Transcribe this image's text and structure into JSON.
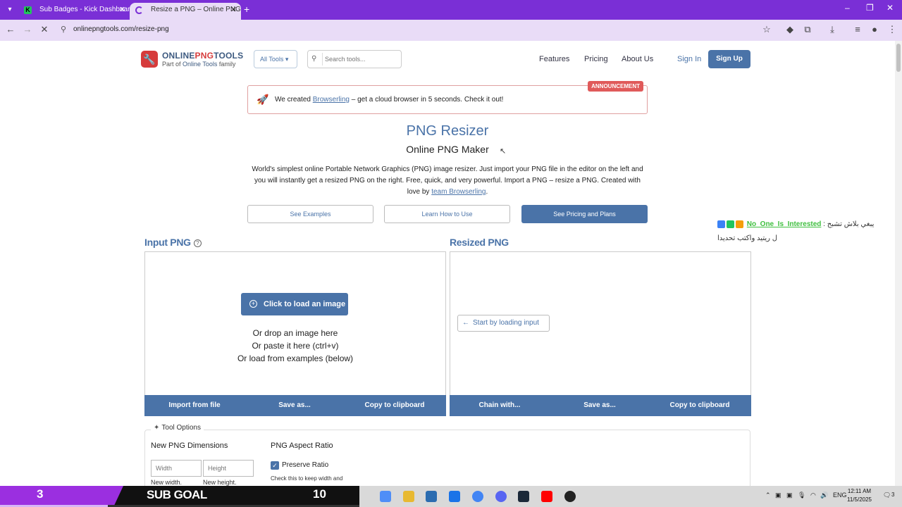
{
  "browser": {
    "tabs": [
      {
        "title": "Sub Badges - Kick Dashboard"
      },
      {
        "title": "Resize a PNG – Online PNG Ma"
      }
    ],
    "url": "onlinepngtools.com/resize-png"
  },
  "header": {
    "brand_online": "ONLINE",
    "brand_png": "PNG",
    "brand_tools": "TOOLS",
    "brand_sub_prefix": "Part of ",
    "brand_sub_link": "Online Tools",
    "brand_sub_suffix": " family",
    "all_tools": "All Tools",
    "search_placeholder": "Search tools...",
    "nav": [
      "Features",
      "Pricing",
      "About Us"
    ],
    "sign_in": "Sign In",
    "sign_up": "Sign Up"
  },
  "announcement": {
    "prefix": "We created ",
    "link": "Browserling",
    "suffix": " – get a cloud browser in 5 seconds. Check it out!",
    "badge": "ANNOUNCEMENT"
  },
  "hero": {
    "title": "PNG Resizer",
    "subtitle": "Online PNG Maker",
    "description": "World's simplest online Portable Network Graphics (PNG) image resizer. Just import your PNG file in the editor on the left and you will instantly get a resized PNG on the right. Free, quick, and very powerful. Import a PNG – resize a PNG. Created with love by ",
    "team_link": "team Browserling",
    "description_end": ".",
    "buttons": {
      "examples": "See Examples",
      "learn": "Learn How to Use",
      "pricing": "See Pricing and Plans"
    }
  },
  "input_panel": {
    "title": "Input PNG",
    "help": "?",
    "load_button": "Click to load an image",
    "drop_lines": [
      "Or drop an image here",
      "Or paste it here (ctrl+v)",
      "Or load from examples (below)"
    ],
    "actions": [
      "Import from file",
      "Save as...",
      "Copy to clipboard"
    ]
  },
  "output_panel": {
    "title": "Resized PNG",
    "start_button": "Start by loading input",
    "actions": [
      "Chain with...",
      "Save as...",
      "Copy to clipboard"
    ]
  },
  "tool_options": {
    "legend": "Tool Options",
    "dimensions_title": "New PNG Dimensions",
    "width_placeholder": "Width",
    "height_placeholder": "Height",
    "width_hint": "New width.",
    "height_hint": "New height.",
    "aspect_title": "PNG Aspect Ratio",
    "preserve_label": "Preserve Ratio",
    "preserve_checked": true,
    "preserve_hint": "Check this to keep width and height proportional."
  },
  "overlay": {
    "username": "No_One_Is_Interested",
    "msg_line1": ": يبغي بلاش تشبح",
    "msg_line2": "ل ريتيد واكتب تحديدا"
  },
  "subgoal": {
    "current": "3",
    "label": "SUB GOAL",
    "goal": "10",
    "progress_fraction": 0.3
  },
  "taskbar": {
    "language": "ENG",
    "time": "12:11 AM",
    "date": "11/5/2025",
    "notifications": "3"
  },
  "colors": {
    "accent": "#4a73a8",
    "brand_red": "#d63b3b",
    "browser_purple": "#7a2fd6"
  }
}
